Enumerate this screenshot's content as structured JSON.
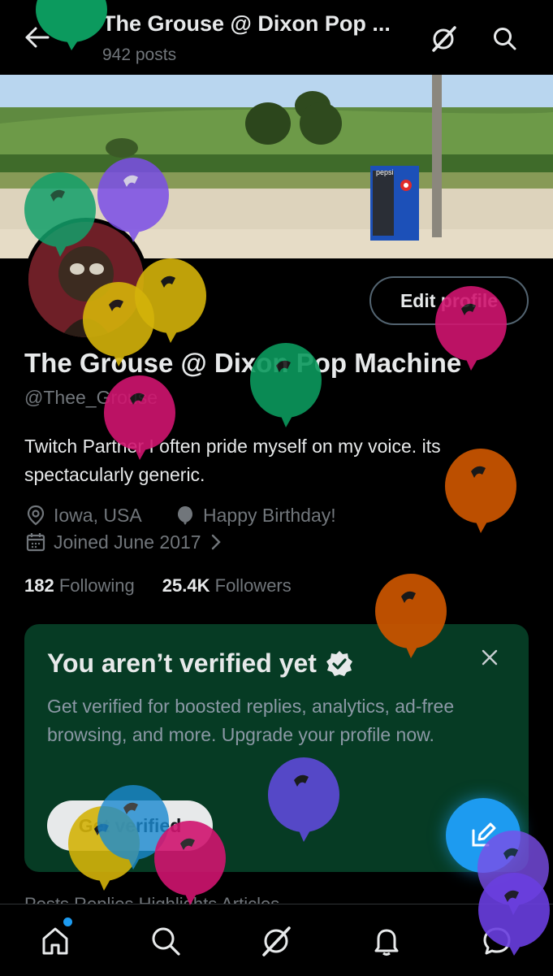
{
  "header": {
    "title": "The Grouse @ Dixon Pop ...",
    "posts_count": "942 posts"
  },
  "profile": {
    "edit_label": "Edit profile",
    "display_name": "The Grouse @ Dixon Pop Machine",
    "handle": "@Thee_Grouse",
    "bio": "Twitch Partner I often pride myself on my voice. its spectacularly generic.",
    "location": "Iowa, USA",
    "birthday": "Happy Birthday!",
    "joined": "Joined June 2017",
    "following_count": "182",
    "following_label": "Following",
    "followers_count": "25.4K",
    "followers_label": "Followers"
  },
  "banner": {
    "vending_brand": "pepsi"
  },
  "verify_card": {
    "title": "You aren’t verified yet",
    "body": "Get verified for boosted replies, analytics, ad-free browsing, and more. Upgrade your profile now.",
    "button_label": "Get verified"
  },
  "profile_tabs_partial": "Posts      Replies      Highlights      Articles",
  "bottom_nav": [
    "home-icon",
    "search-icon",
    "grok-icon",
    "notifications-icon",
    "messages-icon"
  ],
  "colors": {
    "accent": "#1d9bf0",
    "card_bg": "#063b24",
    "background": "#000000"
  }
}
